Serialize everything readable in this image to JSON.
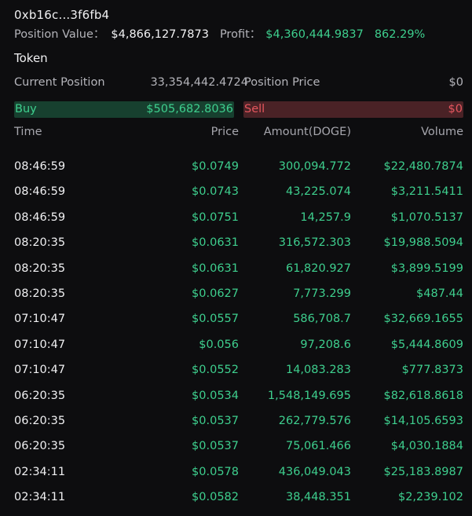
{
  "header": {
    "address": "0xb16c...3f6fb4",
    "position_value_label": "Position Value：",
    "position_value": "$4,866,127.7873",
    "profit_label": "Profit：",
    "profit_value": "$4,360,444.9837",
    "profit_pct": "862.29%"
  },
  "token": {
    "title": "Token",
    "current_position_label": "Current Position",
    "current_position_value": "33,354,442.4724",
    "position_price_label": "Position Price",
    "position_price_value": "$0"
  },
  "bars": {
    "buy_label": "Buy",
    "buy_value": "$505,682.8036",
    "sell_label": "Sell",
    "sell_value": "$0"
  },
  "colors": {
    "buy": "#3ecf8e",
    "sell": "#e5565e",
    "background": "#0d0d0f"
  },
  "table": {
    "headers": [
      "Time",
      "Price",
      "Amount(DOGE)",
      "Volume"
    ],
    "rows": [
      {
        "time": "08:46:59",
        "price": "$0.0749",
        "amount": "300,094.772",
        "volume": "$22,480.7874"
      },
      {
        "time": "08:46:59",
        "price": "$0.0743",
        "amount": "43,225.074",
        "volume": "$3,211.5411"
      },
      {
        "time": "08:46:59",
        "price": "$0.0751",
        "amount": "14,257.9",
        "volume": "$1,070.5137"
      },
      {
        "time": "08:20:35",
        "price": "$0.0631",
        "amount": "316,572.303",
        "volume": "$19,988.5094"
      },
      {
        "time": "08:20:35",
        "price": "$0.0631",
        "amount": "61,820.927",
        "volume": "$3,899.5199"
      },
      {
        "time": "08:20:35",
        "price": "$0.0627",
        "amount": "7,773.299",
        "volume": "$487.44"
      },
      {
        "time": "07:10:47",
        "price": "$0.0557",
        "amount": "586,708.7",
        "volume": "$32,669.1655"
      },
      {
        "time": "07:10:47",
        "price": "$0.056",
        "amount": "97,208.6",
        "volume": "$5,444.8609"
      },
      {
        "time": "07:10:47",
        "price": "$0.0552",
        "amount": "14,083.283",
        "volume": "$777.8373"
      },
      {
        "time": "06:20:35",
        "price": "$0.0534",
        "amount": "1,548,149.695",
        "volume": "$82,618.8618"
      },
      {
        "time": "06:20:35",
        "price": "$0.0537",
        "amount": "262,779.576",
        "volume": "$14,105.6593"
      },
      {
        "time": "06:20:35",
        "price": "$0.0537",
        "amount": "75,061.466",
        "volume": "$4,030.1884"
      },
      {
        "time": "02:34:11",
        "price": "$0.0578",
        "amount": "436,049.043",
        "volume": "$25,183.8987"
      },
      {
        "time": "02:34:11",
        "price": "$0.0582",
        "amount": "38,448.351",
        "volume": "$2,239.102"
      }
    ]
  }
}
